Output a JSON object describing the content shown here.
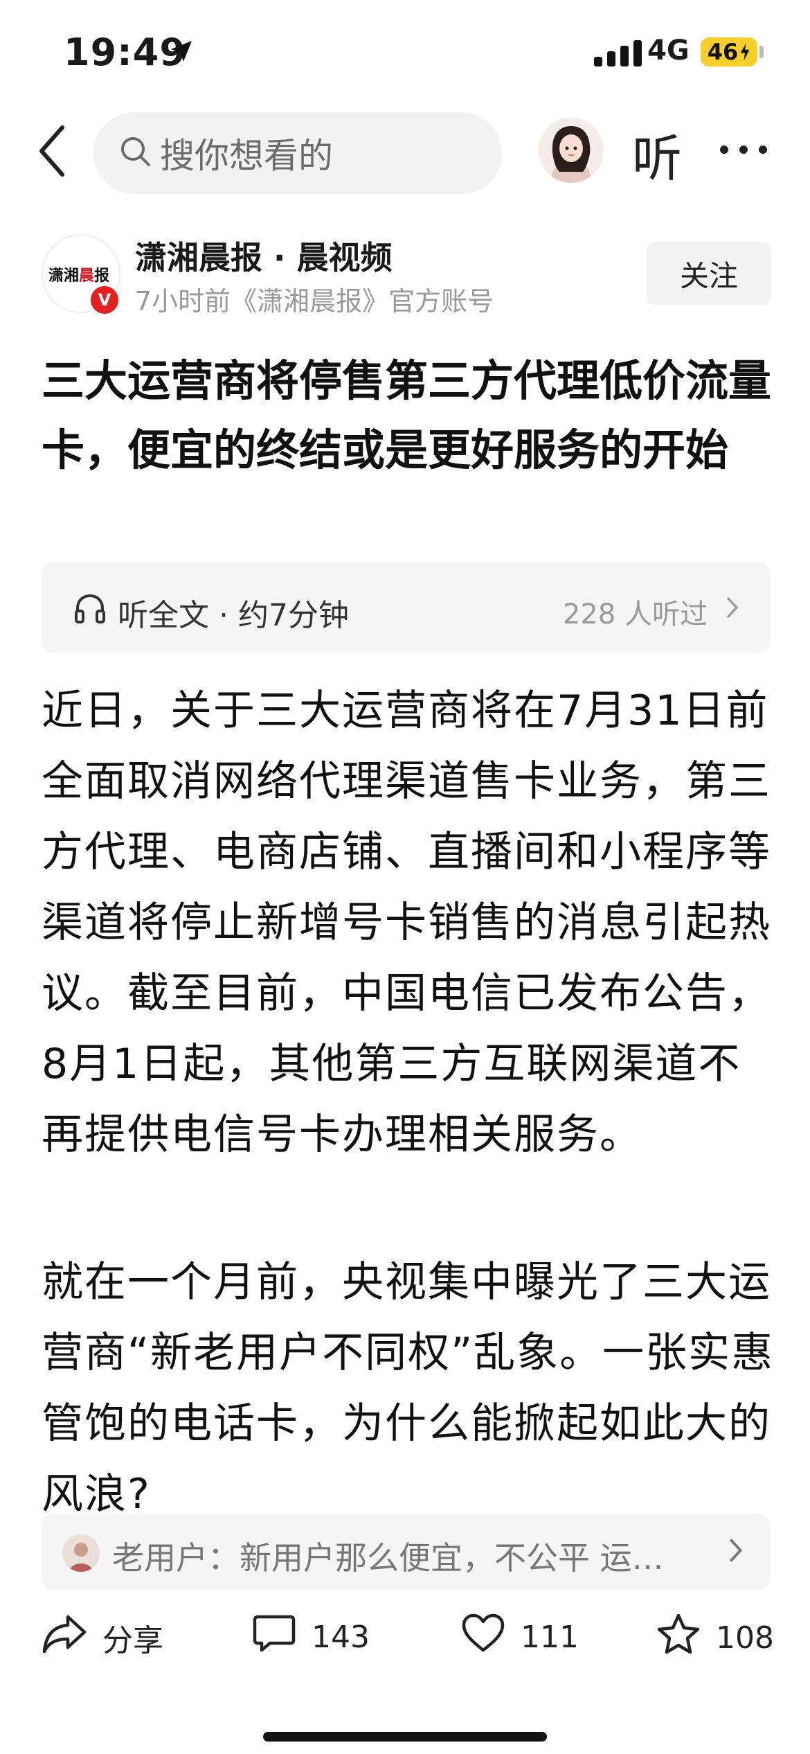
{
  "status_bar": {
    "time": "19:49",
    "network": "4G",
    "battery": "46"
  },
  "nav": {
    "search_placeholder": "搜你想看的",
    "listen_label": "听"
  },
  "author": {
    "logo_text_a": "潇湘",
    "logo_text_b": "晨",
    "logo_text_c": "报",
    "badge": "V",
    "name": "潇湘晨报 · 晨视频",
    "meta": "7小时前《潇湘晨报》官方账号",
    "follow_label": "关注"
  },
  "article": {
    "title": "三大运营商将停售第三方代理低价流量卡，便宜的终结或是更好服务的开始",
    "audio_label": "听全文 · 约7分钟",
    "audio_count": "228 人听过",
    "paragraphs": [
      "近日，关于三大运营商将在7月31日前全面取消网络代理渠道售卡业务，第三方代理、电商店铺、直播间和小程序等渠道将停止新增号卡销售的消息引起热议。截至目前，中国电信已发布公告，8月1日起，其他第三方互联网渠道不再提供电信号卡办理相关服务。",
      "就在一个月前，央视集中曝光了三大运营商“新老用户不同权”乱象。一张实惠管饱的电话卡，为什么能掀起如此大的风浪?"
    ]
  },
  "comment_preview": {
    "text": "老用户：新用户那么便宜，不公平 运…"
  },
  "actions": {
    "share": "分享",
    "comments": "143",
    "likes": "111",
    "favorites": "108"
  },
  "colors": {
    "accent_red": "#e62020",
    "battery_yellow": "#f6cf2a",
    "muted_gray": "#999999"
  }
}
